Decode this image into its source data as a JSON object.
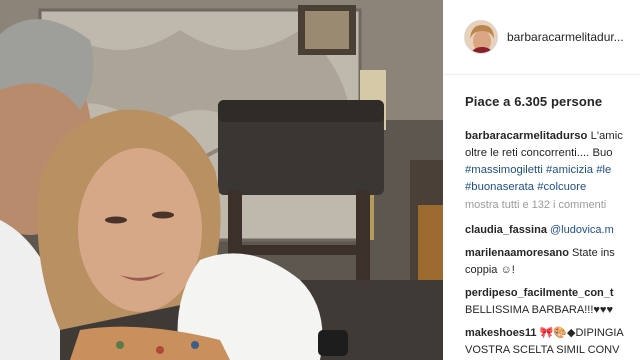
{
  "post": {
    "username": "barbaracarmelitadur...",
    "likes_text": "Piace a 6.305 persone"
  },
  "caption": {
    "user": "barbaracarmelitadurso",
    "line1_text": "L'amic",
    "line2_text": "oltre le reti concorrenti.... Buo",
    "line3_tags": [
      "#massimogiletti",
      "#amicizia",
      "#le"
    ],
    "line4_tags": [
      "#buonaserata",
      "#colcuore"
    ]
  },
  "show_all_text": "mostra tutti e 132 i commenti",
  "comments": [
    {
      "user": "claudia_fassina",
      "mention": "@ludovica.m"
    },
    {
      "user": "marilenaamoresano",
      "text": "State ins",
      "text2": "coppia ☺!"
    },
    {
      "user": "perdipeso_facilmente_con_t",
      "text2": "BELLISSIMA BARBARA!!!♥♥♥"
    },
    {
      "user": "makeshoes11",
      "text": "🎀🎨◆DIPINGIA",
      "text2": "VOSTRA SCELTA SIMIL CONV"
    }
  ]
}
